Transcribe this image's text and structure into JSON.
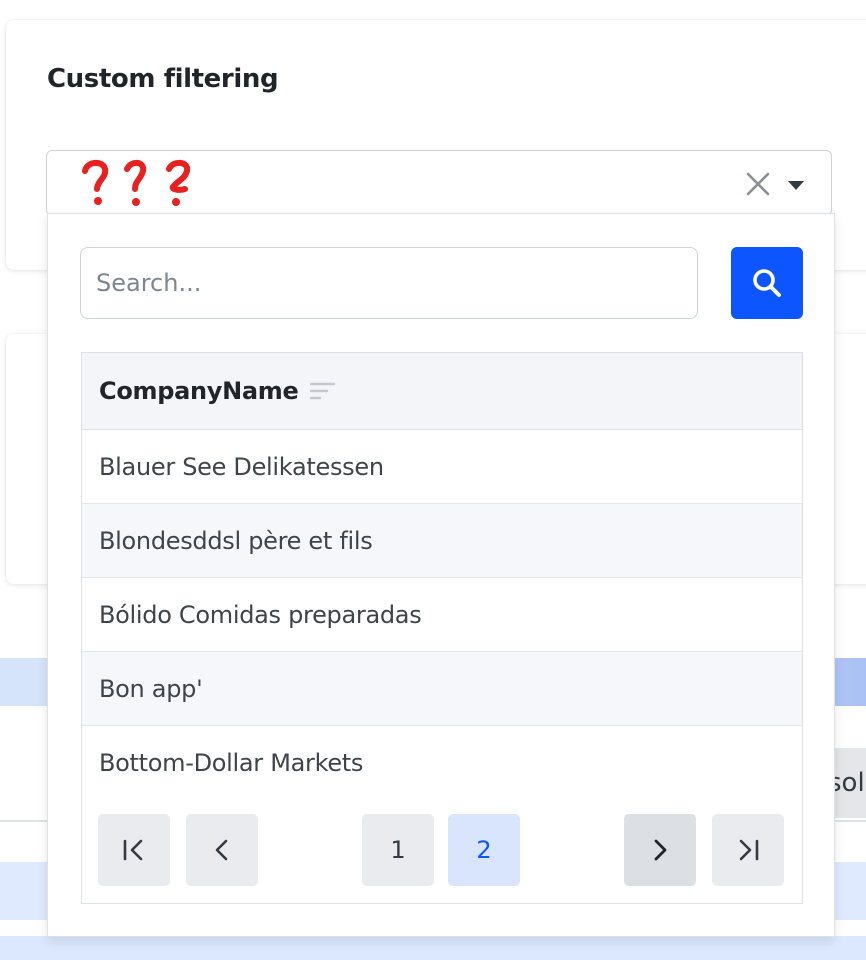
{
  "card": {
    "title": "Custom filtering"
  },
  "select": {
    "value_glyphs": "? ? ?"
  },
  "dropdown": {
    "search": {
      "placeholder": "Search..."
    },
    "grid": {
      "column_header": "CompanyName",
      "rows": [
        "Blauer See Delikatessen",
        "Blondesddsl père et fils",
        "Bólido Comidas preparadas",
        "Bon app'",
        "Bottom-Dollar Markets"
      ]
    },
    "pager": {
      "pages": [
        "1",
        "2"
      ],
      "current_page": "2"
    }
  },
  "background": {
    "partial_button_text": "sold"
  },
  "colors": {
    "accent": "#0d55ff",
    "annotation": "#e8201f",
    "active_page_bg": "#d9e5fd"
  },
  "icons": {
    "clear": "close-icon",
    "toggle": "caret-down-icon",
    "search": "search-icon",
    "sort": "sort-icon",
    "first": "first-page-icon",
    "prev": "chevron-left-icon",
    "next": "chevron-right-icon",
    "last": "last-page-icon"
  }
}
